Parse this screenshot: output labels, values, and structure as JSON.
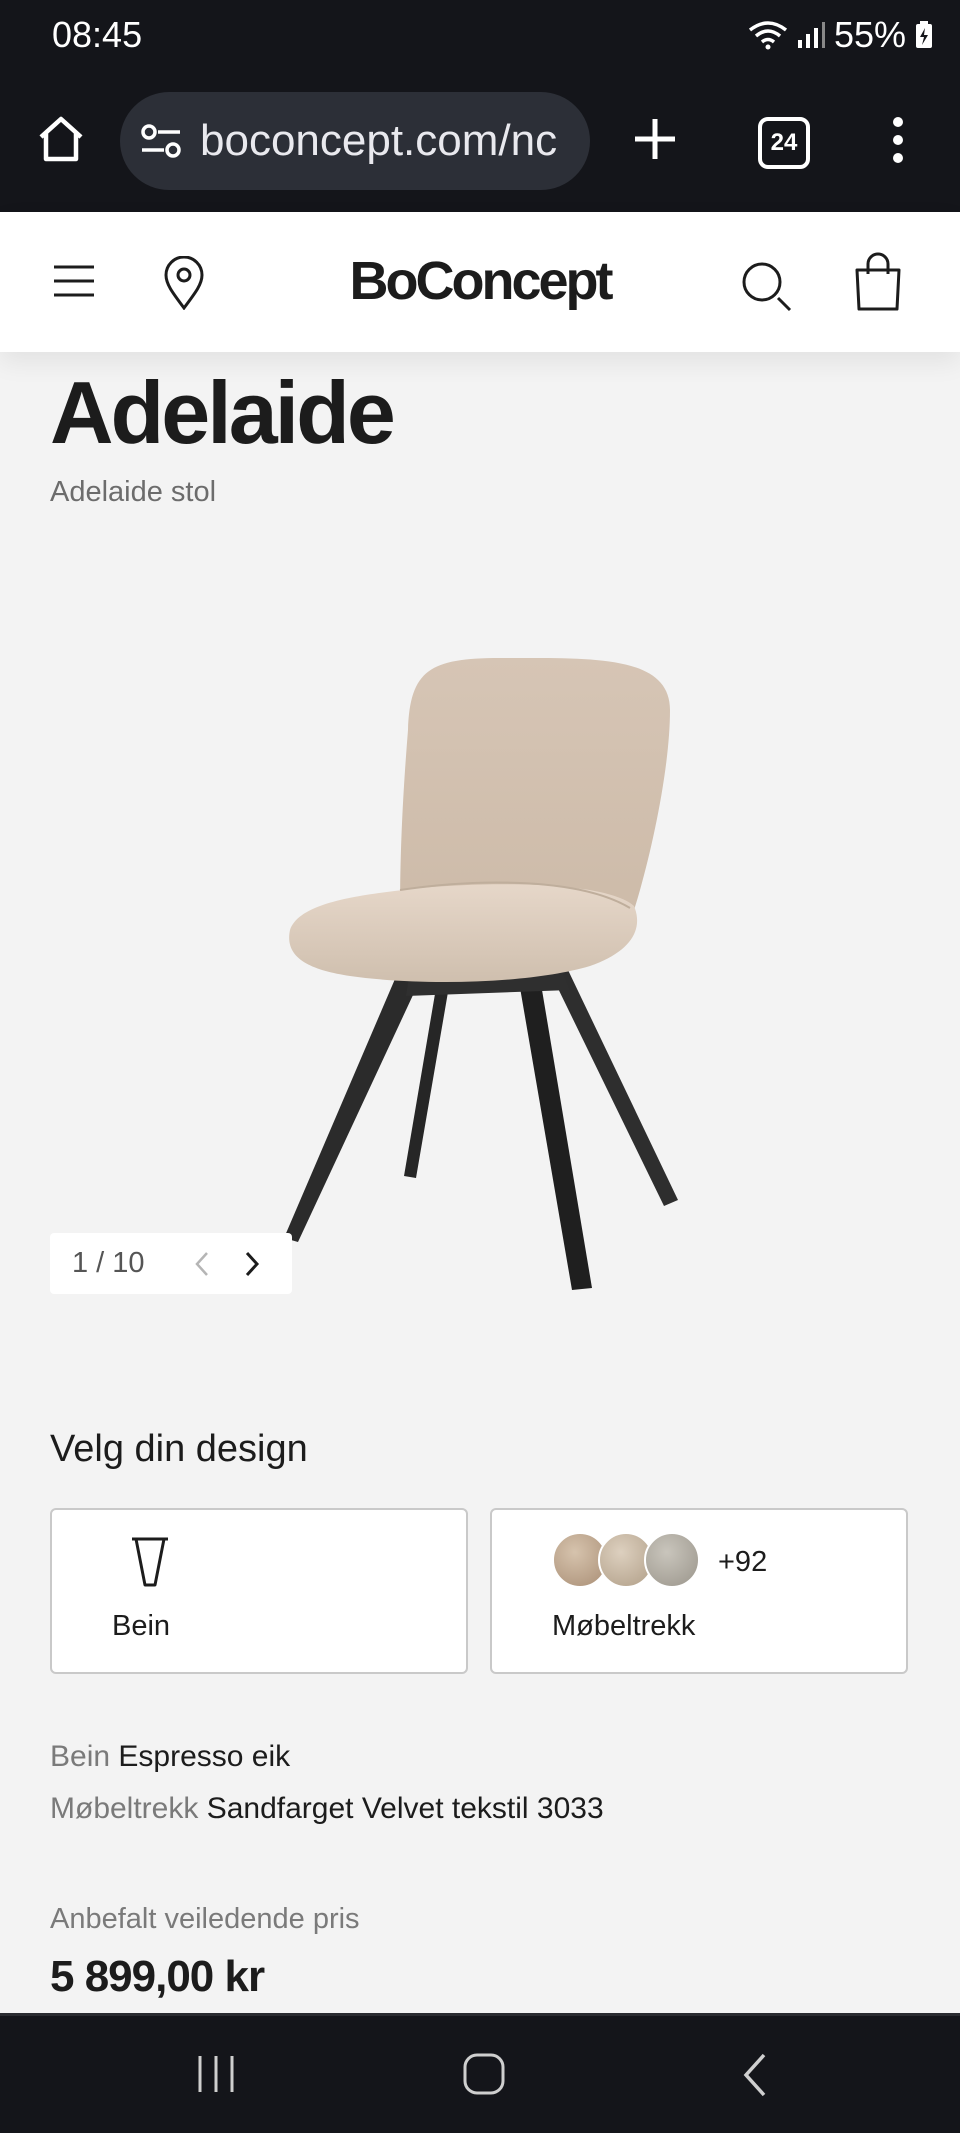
{
  "status_bar": {
    "time": "08:45",
    "battery": "55%"
  },
  "browser": {
    "url": "boconcept.com/nc",
    "tab_count": "24"
  },
  "site": {
    "logo": "BoConcept"
  },
  "product": {
    "title": "Adelaide",
    "subtitle": "Adelaide stol",
    "image_counter": "1 / 10"
  },
  "design": {
    "heading": "Velg din design",
    "legs_label": "Bein",
    "upholstery_label": "Møbeltrekk",
    "more_swatches": "+92"
  },
  "summary": [
    {
      "key": "Bein",
      "value": "Espresso eik"
    },
    {
      "key": "Møbeltrekk",
      "value": "Sandfarget Velvet tekstil 3033"
    }
  ],
  "price": {
    "label": "Anbefalt veiledende pris",
    "value": "5 899,00 kr"
  },
  "colors": {
    "chrome": "#14151a",
    "page_background": "#f3f3f3",
    "seat": "#d9c8b8",
    "legs": "#2b2b2b"
  }
}
